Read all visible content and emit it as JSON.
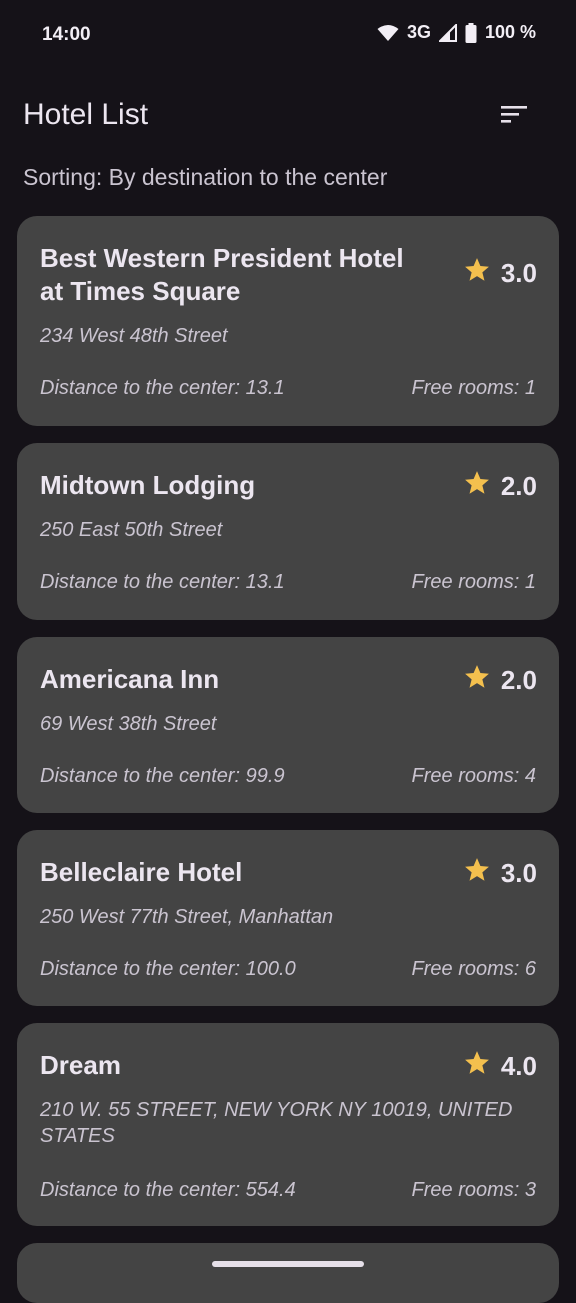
{
  "status_bar": {
    "time": "14:00",
    "network": "3G",
    "battery": "100 %"
  },
  "header": {
    "title": "Hotel List",
    "sort_icon": "sort-icon"
  },
  "sorting_label": "Sorting: By destination to the center",
  "colors": {
    "background": "#151218",
    "card": "#444444",
    "star": "#f4c04e"
  },
  "hotels": [
    {
      "name": "Best Western President Hotel at Times Square",
      "rating": "3.0",
      "address": "234 West 48th Street",
      "distance": "Distance to the center: 13.1",
      "rooms": "Free rooms: 1"
    },
    {
      "name": "Midtown Lodging",
      "rating": "2.0",
      "address": "250 East 50th Street",
      "distance": "Distance to the center: 13.1",
      "rooms": "Free rooms: 1"
    },
    {
      "name": "Americana Inn",
      "rating": "2.0",
      "address": "69 West 38th Street",
      "distance": "Distance to the center: 99.9",
      "rooms": "Free rooms: 4"
    },
    {
      "name": "Belleclaire Hotel",
      "rating": "3.0",
      "address": "250 West 77th Street, Manhattan",
      "distance": "Distance to the center: 100.0",
      "rooms": "Free rooms: 6"
    },
    {
      "name": "Dream",
      "rating": "4.0",
      "address": "210 W. 55 STREET, NEW YORK NY 10019, UNITED STATES",
      "distance": "Distance to the center: 554.4",
      "rooms": "Free rooms: 3"
    }
  ]
}
